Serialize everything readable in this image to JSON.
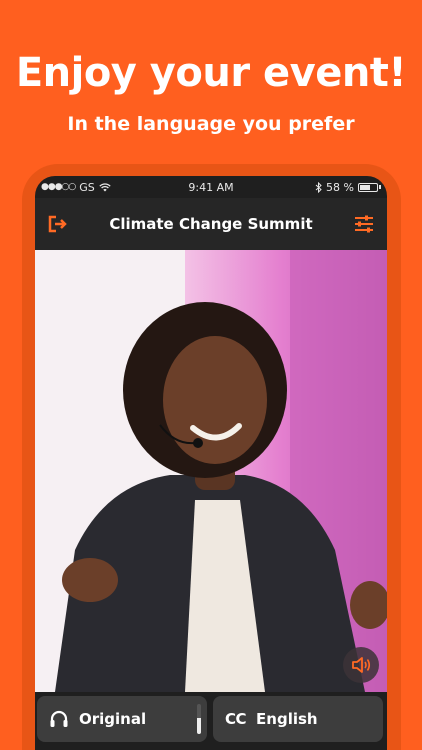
{
  "promo": {
    "headline": "Enjoy your event!",
    "subheadline": "In the language you prefer"
  },
  "status_bar": {
    "carrier": "GS",
    "signal_dots": "●●●○○",
    "time": "9:41 AM",
    "battery": "58 %"
  },
  "nav": {
    "title": "Climate Change Summit",
    "exit_icon": "exit-icon",
    "settings_icon": "sliders-icon"
  },
  "controls": {
    "audio_label": "Original",
    "audio_icon": "headphones-icon",
    "audio_level": 0.55,
    "caption_icon": "CC",
    "caption_label": "English"
  },
  "colors": {
    "brand": "#ff5f1f",
    "accent": "#ff6a24"
  }
}
